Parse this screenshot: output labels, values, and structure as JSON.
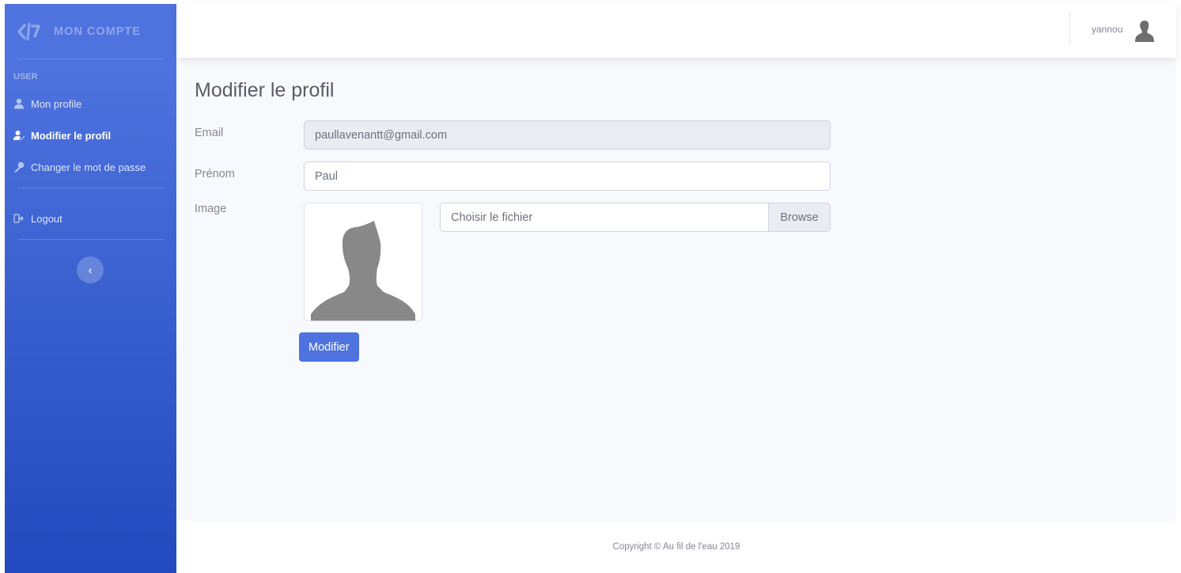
{
  "sidebar": {
    "brand": "MON COMPTE",
    "heading": "USER",
    "items": [
      {
        "label": "Mon profile",
        "icon": "user-icon",
        "active": false
      },
      {
        "label": "Modifier le profil",
        "icon": "user-edit-icon",
        "active": true
      },
      {
        "label": "Changer le mot de passe",
        "icon": "key-icon",
        "active": false
      }
    ],
    "logout": {
      "label": "Logout",
      "icon": "sign-out-icon"
    },
    "toggle_symbol": "‹"
  },
  "topbar": {
    "username": "yannou",
    "avatar_icon": "user-avatar-icon"
  },
  "main": {
    "title": "Modifier le profil",
    "form": {
      "email_label": "Email",
      "email_value": "paullavenantt@gmail.com",
      "firstname_label": "Prénom",
      "firstname_value": "Paul",
      "image_label": "Image",
      "file_placeholder": "Choisir le fichier",
      "browse_label": "Browse",
      "submit_label": "Modifier"
    }
  },
  "footer": {
    "copyright": "Copyright © Au fil de l'eau 2019"
  },
  "colors": {
    "primary": "#4e73df",
    "sidebar_gradient_end": "#224abe",
    "background": "#f8f9fc",
    "text_muted": "#858796"
  }
}
